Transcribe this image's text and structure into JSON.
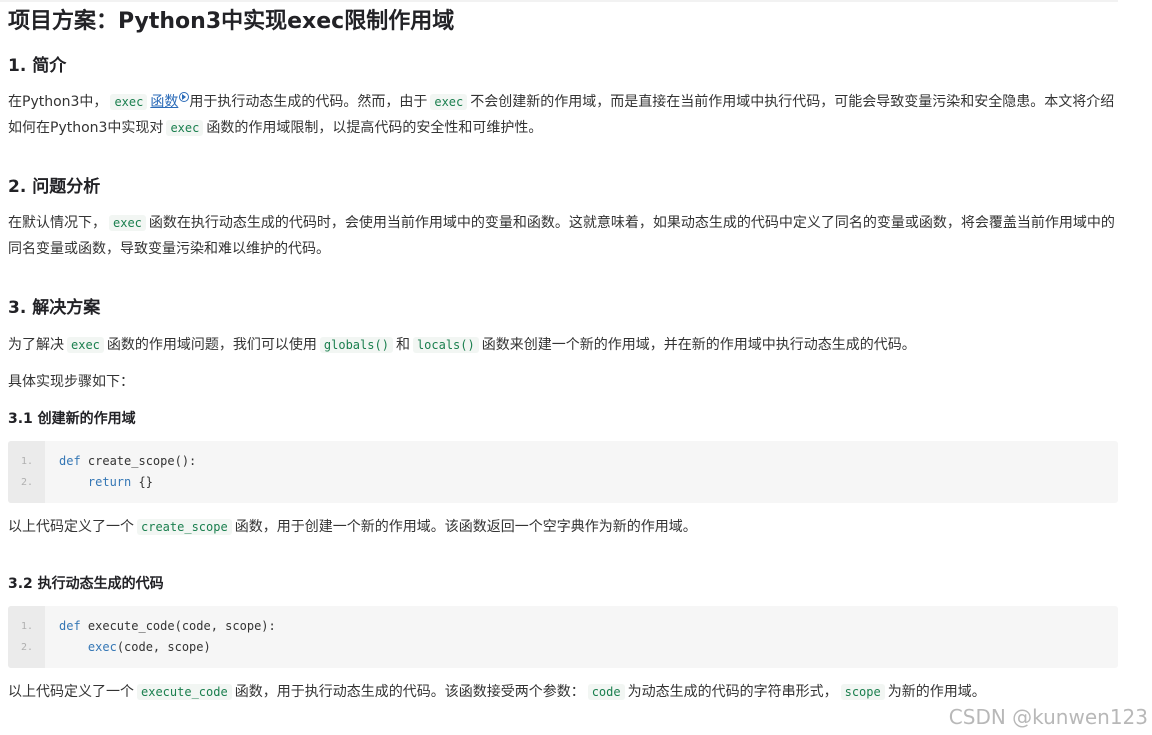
{
  "title": "项目方案：Python3中实现exec限制作用域",
  "sections": [
    {
      "heading": "1. 简介",
      "paragraph": {
        "t1": "在Python3中，",
        "c1": "exec",
        "link": "函数",
        "t2": "用于执行动态生成的代码。然而，由于",
        "c2": "exec",
        "t3": "不会创建新的作用域，而是直接在当前作用域中执行代码，可能会导致变量污染和安全隐患。本文将介绍如何在Python3中实现对",
        "c3": "exec",
        "t4": "函数的作用域限制，以提高代码的安全性和可维护性。"
      }
    },
    {
      "heading": "2. 问题分析",
      "paragraph": {
        "t1": "在默认情况下，",
        "c1": "exec",
        "t2": "函数在执行动态生成的代码时，会使用当前作用域中的变量和函数。这就意味着，如果动态生成的代码中定义了同名的变量或函数，将会覆盖当前作用域中的同名变量或函数，导致变量污染和难以维护的代码。"
      }
    },
    {
      "heading": "3. 解决方案",
      "paragraph": {
        "t1": "为了解决",
        "c1": "exec",
        "t2": "函数的作用域问题，我们可以使用",
        "c2": "globals()",
        "t3": "和",
        "c3": "locals()",
        "t4": "函数来创建一个新的作用域，并在新的作用域中执行动态生成的代码。"
      },
      "steps_intro": "具体实现步骤如下：",
      "subsections": [
        {
          "heading": "3.1 创建新的作用域",
          "code": {
            "line_numbers": [
              "1.",
              "2."
            ],
            "l1_kw": "def",
            "l1_rest": " create_scope():",
            "l2_indent": "    ",
            "l2_kw": "return",
            "l2_rest": " {}"
          },
          "after": {
            "t1": "以上代码定义了一个",
            "c1": "create_scope",
            "t2": "函数，用于创建一个新的作用域。该函数返回一个空字典作为新的作用域。"
          }
        },
        {
          "heading": "3.2 执行动态生成的代码",
          "code": {
            "line_numbers": [
              "1.",
              "2."
            ],
            "l1_kw": "def",
            "l1_rest": " execute_code(code, scope):",
            "l2_indent": "    ",
            "l2_kw": "exec",
            "l2_rest": "(code, scope)"
          },
          "after": {
            "t1": "以上代码定义了一个",
            "c1": "execute_code",
            "t2": "函数，用于执行动态生成的代码。该函数接受两个参数：",
            "c2": "code",
            "t3": "为动态生成的代码的字符串形式，",
            "c3": "scope",
            "t4": "为新的作用域。"
          }
        }
      ]
    }
  ],
  "watermark": "CSDN @kunwen123",
  "colors": {
    "inline_code_bg": "#f2f6f3",
    "inline_code_text": "#1a7f4e",
    "link": "#2b6bb8",
    "keyword": "#3577b5"
  }
}
